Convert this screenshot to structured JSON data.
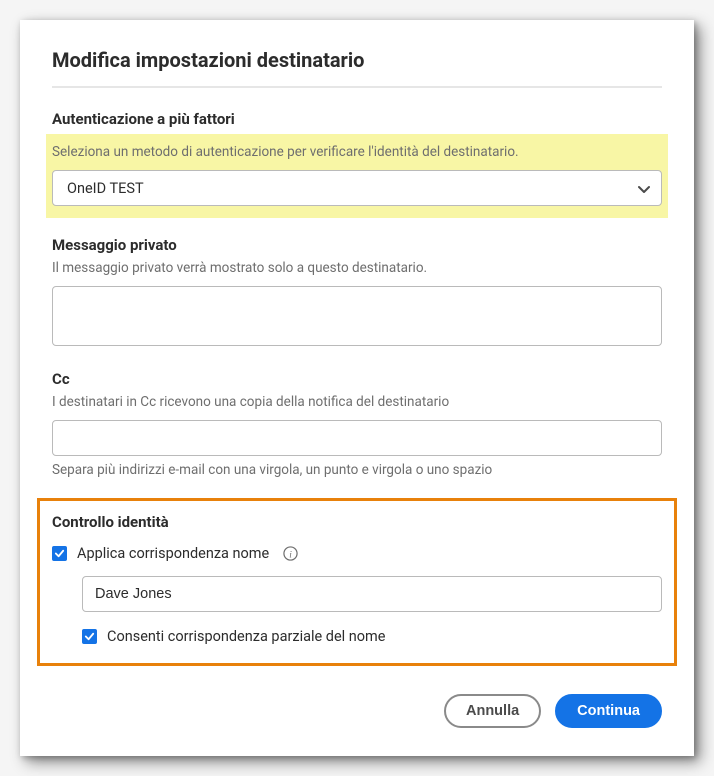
{
  "dialog": {
    "title": "Modifica impostazioni destinatario"
  },
  "auth": {
    "label": "Autenticazione a più fattori",
    "help": "Seleziona un metodo di autenticazione per verificare l'identità del destinatario.",
    "selected": "OneID TEST"
  },
  "privateMessage": {
    "label": "Messaggio privato",
    "help": "Il messaggio privato verrà mostrato solo a questo destinatario.",
    "value": ""
  },
  "cc": {
    "label": "Cc",
    "help": "I destinatari in Cc ricevono una copia della notifica del destinatario",
    "value": "",
    "hint": "Separa più indirizzi e-mail con una virgola, un punto e virgola o uno spazio"
  },
  "identity": {
    "label": "Controllo identità",
    "enforceName": {
      "label": "Applica corrispondenza nome",
      "checked": true
    },
    "nameValue": "Dave Jones",
    "allowPartial": {
      "label": "Consenti corrispondenza parziale del nome",
      "checked": true
    }
  },
  "buttons": {
    "cancel": "Annulla",
    "continue": "Continua"
  }
}
